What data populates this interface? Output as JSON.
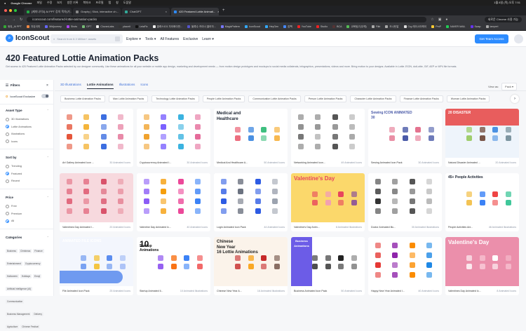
{
  "os_menu": {
    "items": [
      "Google Chrome",
      "파일",
      "수정",
      "보기",
      "방문 기록",
      "북마크",
      "프로필",
      "탭",
      "창",
      "도움말"
    ],
    "clock": "1월 8일 (목) 오후 7:51"
  },
  "browser": {
    "tabs": [
      {
        "label": "[제미나이3] AI PPT 강의 목차(가..."
      },
      {
        "label": "Graphy | Slick, interactive ch..."
      },
      {
        "label": "ChatGPT"
      },
      {
        "label": "420 Featured Lottie Animati..."
      }
    ],
    "url": "iconscout.com/featured-lottie-animation-packs",
    "update_label": "새로운 Chrome 사용 가능",
    "bookmarks": [
      {
        "label": "위촉_AI PPT",
        "color": "#3a3"
      },
      {
        "label": "자유이미",
        "color": "#e84"
      },
      {
        "label": "Midjourney",
        "color": "#66f"
      },
      {
        "label": "Shots",
        "color": "#a4e"
      },
      {
        "label": "GPT",
        "color": "#7b7"
      },
      {
        "label": "ClovanLabs",
        "color": "#eee"
      },
      {
        "label": "placeit",
        "color": "#333"
      },
      {
        "label": "LetaFix",
        "color": "#111"
      },
      {
        "label": "클래스101 자이화이먼...",
        "color": "#eee"
      },
      {
        "label": "블록수 카이너 클러자...",
        "color": "#55c"
      },
      {
        "label": "MagicPattern",
        "color": "#77f"
      },
      {
        "label": "IconScout",
        "color": "#3af"
      },
      {
        "label": "HeyGen",
        "color": "#3af"
      },
      {
        "label": "잡팩",
        "color": "#48f"
      },
      {
        "label": "YouTube",
        "color": "#e22"
      },
      {
        "label": "Studio",
        "color": "#e22"
      },
      {
        "label": "BCA",
        "color": "#533"
      },
      {
        "label": "교육팀고(우헤)",
        "color": "#5b5"
      },
      {
        "label": "Flikt",
        "color": "#aaa"
      },
      {
        "label": "도나턴말",
        "color": "#aaa"
      },
      {
        "label": "Crg 레이시아헤이",
        "color": "#ddd"
      },
      {
        "label": "PmP",
        "color": "#fc3"
      },
      {
        "label": "NAVER MAIL",
        "color": "#2c5"
      },
      {
        "label": "Swap",
        "color": "#63e"
      },
      {
        "label": "lampert",
        "color": "#aaa"
      }
    ],
    "all_bookmarks": "모든 북마크"
  },
  "header": {
    "logo": "IconScout",
    "search_placeholder": "Search from 8.3 Million+ assets",
    "nav": [
      "Explore ▾",
      "Tools ▾",
      "All Features",
      "Exclusive",
      "Learn ▾"
    ],
    "cta": "Get Team Access"
  },
  "page": {
    "title": "420 Featured Lottie Animation Packs",
    "description": "Get access to 420 Featured Lottie Animation Packs selected by our designer community. Use these animations for all your website or mobile app design, marketing and development needs — from motion design prototypes and mockups to social media collaterals, infographics, presentations, videos and more. Bring motion to your designs. Available in Lottie JSON, dotLottie, GIF, AEP or MP4 file formats.",
    "tabs": [
      "3D Illustrations",
      "Lottie Animations",
      "Illustrations",
      "Icons"
    ],
    "view_as_label": "View as:",
    "view_as_value": "Pack ▾",
    "chips": [
      "Business Lottie Animation Packs",
      "Man Lottie Animation Packs",
      "Technology Lottie Animation Packs",
      "People Lottie Animation Packs",
      "Communication Lottie Animation Packs",
      "Person Lottie Animation Packs",
      "Character Lottie Animation Packs",
      "Finance Lottie Animation Packs",
      "Woman Lottie Animation Packs"
    ]
  },
  "filters": {
    "title": "Filters",
    "exclusive": "IconScout Exclusive",
    "asset_type": {
      "title": "Asset Type",
      "options": [
        "3D Illustrations",
        "Lottie Animations",
        "Illustrations",
        "Icons"
      ],
      "selected": 1
    },
    "sort_by": {
      "title": "Sort by",
      "options": [
        "Trending",
        "Featured",
        "Recent"
      ],
      "selected": 1
    },
    "price": {
      "title": "Price",
      "options": [
        "Free",
        "Premium",
        "All"
      ],
      "selected": 2
    },
    "categories": {
      "title": "Categories",
      "items": [
        "Business",
        "Christmas",
        "Finance",
        "Entertainment",
        "Cryptocurrency",
        "Halloween",
        "Holidays",
        "Emoji",
        "Artificial Intelligence (AI)",
        "Communication",
        "Business Management",
        "Delivery",
        "Agriculture",
        "Chinese Festival"
      ]
    }
  },
  "cards": [
    {
      "title": "Art Gallery Animated Icon ...",
      "count": "30 Animated Icons",
      "bg": "#ffffff",
      "icons": [
        "#e5553b",
        "#f4b43b",
        "#3c6ee0",
        "#e88aa8"
      ],
      "text": []
    },
    {
      "title": "Cryptocurrency Animated I...",
      "count": "30 Animated Icons",
      "bg": "#ffffff",
      "icons": [
        "#f0a22e",
        "#7b61ff",
        "#3bb3e0",
        "#e56b9a"
      ],
      "text": []
    },
    {
      "title": "Medical And Healthcare A...",
      "count": "50 Animated Icons",
      "bg": "#ffffff",
      "icons": [
        "#e84a5f",
        "#4a90e2",
        "#3fbf7f",
        "#f5a623"
      ],
      "text": [
        "Medical and",
        "Healthcare"
      ],
      "tc": "#1c2432"
    },
    {
      "title": "Networking Animated Icon...",
      "count": "49 Animated Icons",
      "bg": "#ffffff",
      "icons": [
        "#777",
        "#999",
        "#555",
        "#aaa"
      ],
      "text": []
    },
    {
      "title": "Sewing Animated Icon Pack",
      "count": "30 Animated Icons",
      "bg": "#ffffff",
      "icons": [
        "#e4738f",
        "#4a5aa8",
        "#e4738f",
        "#4a5aa8"
      ],
      "text": [
        "Sewing ICON ANIMATED",
        "30"
      ],
      "tc": "#4a5aa8"
    },
    {
      "title": "Natural Disaster Animated ...",
      "count": "20 Animated Icons",
      "bg": "#eef4fb",
      "icons": [
        "#8bc34a",
        "#795548",
        "#4a90e2",
        "#607d8b"
      ],
      "text": [
        "20 DISASTER"
      ],
      "tc": "#ffffff",
      "band": "#e85d5d"
    },
    {
      "title": "Valentines Day Animated I...",
      "count": "20 Animated Icons",
      "bg": "#f7d9de",
      "icons": [
        "#e26a7f",
        "#e26a7f",
        "#d9536b",
        "#e88f9f"
      ],
      "text": []
    },
    {
      "title": "Valentine Day Animated Ic...",
      "count": "40 Animated Icons",
      "bg": "#ffffff",
      "icons": [
        "#8b5cf6",
        "#f59e0b",
        "#ec4899",
        "#3b82f6"
      ],
      "text": []
    },
    {
      "title": "Login Animated Icon Pack",
      "count": "44 Animated Icons",
      "bg": "#ffffff",
      "icons": [
        "#2d5be3",
        "#6b7280",
        "#2d5be3",
        "#9ca3af"
      ],
      "text": []
    },
    {
      "title": "Valentine's Day Anim...",
      "count": "8 Animated Illustrations",
      "bg": "#fbd86b",
      "icons": [
        "#e8455d",
        "#f2a1b0",
        "#e8455d",
        "#7b3fa0"
      ],
      "text": [
        "Valentine's Day"
      ],
      "tc": "#e8455d"
    },
    {
      "title": "Doctor Animated Illu...",
      "count": "30 Animated Illustrations",
      "bg": "#ffffff",
      "icons": [
        "#333",
        "#888",
        "#555",
        "#bbb"
      ],
      "text": []
    },
    {
      "title": "People Activities Ani...",
      "count": "46 Animated Illustrations",
      "bg": "#ffffff",
      "icons": [
        "#f0b429",
        "#3b82f6",
        "#ef4444",
        "#10b981"
      ],
      "text": [
        "45+ People Activities"
      ],
      "tc": "#1c2432"
    },
    {
      "title": "File Animated Icon Pack",
      "count": "25 Animated Icons",
      "bg": "#f3f6fd",
      "icons": [
        "#5b8def",
        "#f4c542",
        "#5b8def",
        "#9bb7f5"
      ],
      "text": [
        "ANIMATED FILE ICONS"
      ],
      "tc": "#ffffff",
      "band": "#6f9af0"
    },
    {
      "title": "Startup Animated Il...",
      "count": "10 Animated Illustrations",
      "bg": "#ffffff",
      "icons": [
        "#7c3aed",
        "#f97316",
        "#3b82f6",
        "#ef4444"
      ],
      "text": [
        "10",
        "Startup",
        "Animations"
      ],
      "tc": "#111111"
    },
    {
      "title": "Chinese New Year A...",
      "count": "16 Animated Illustrations",
      "bg": "#fbf3ea",
      "icons": [
        "#c62828",
        "#f9a825",
        "#c62828",
        "#6d4c41"
      ],
      "text": [
        "Chinese",
        "New Year",
        "16 Lottie Animations"
      ],
      "tc": "#222222"
    },
    {
      "title": "Business Animated Icon Pack",
      "count": "50 Animated Icons",
      "bg": "#ffffff",
      "icons": [
        "#222",
        "#555",
        "#222",
        "#777"
      ],
      "text": [
        "Business",
        "Animations"
      ],
      "tc": "#ffffff",
      "band": "#6c5ce7"
    },
    {
      "title": "Happy New Year Animated I...",
      "count": "40 Animated Icons",
      "bg": "#ffffff",
      "icons": [
        "#e53935",
        "#8e24aa",
        "#fb8c00",
        "#1e88e5"
      ],
      "text": []
    },
    {
      "title": "Valentines Day Animated Ic...",
      "count": "8 Animated Icons",
      "bg": "#eb8fab",
      "icons": [
        "#ffffff",
        "#f7c1d1",
        "#ffffff",
        "#f7c1d1"
      ],
      "text": [
        "Valentine's Day"
      ],
      "tc": "#ffffff"
    }
  ]
}
